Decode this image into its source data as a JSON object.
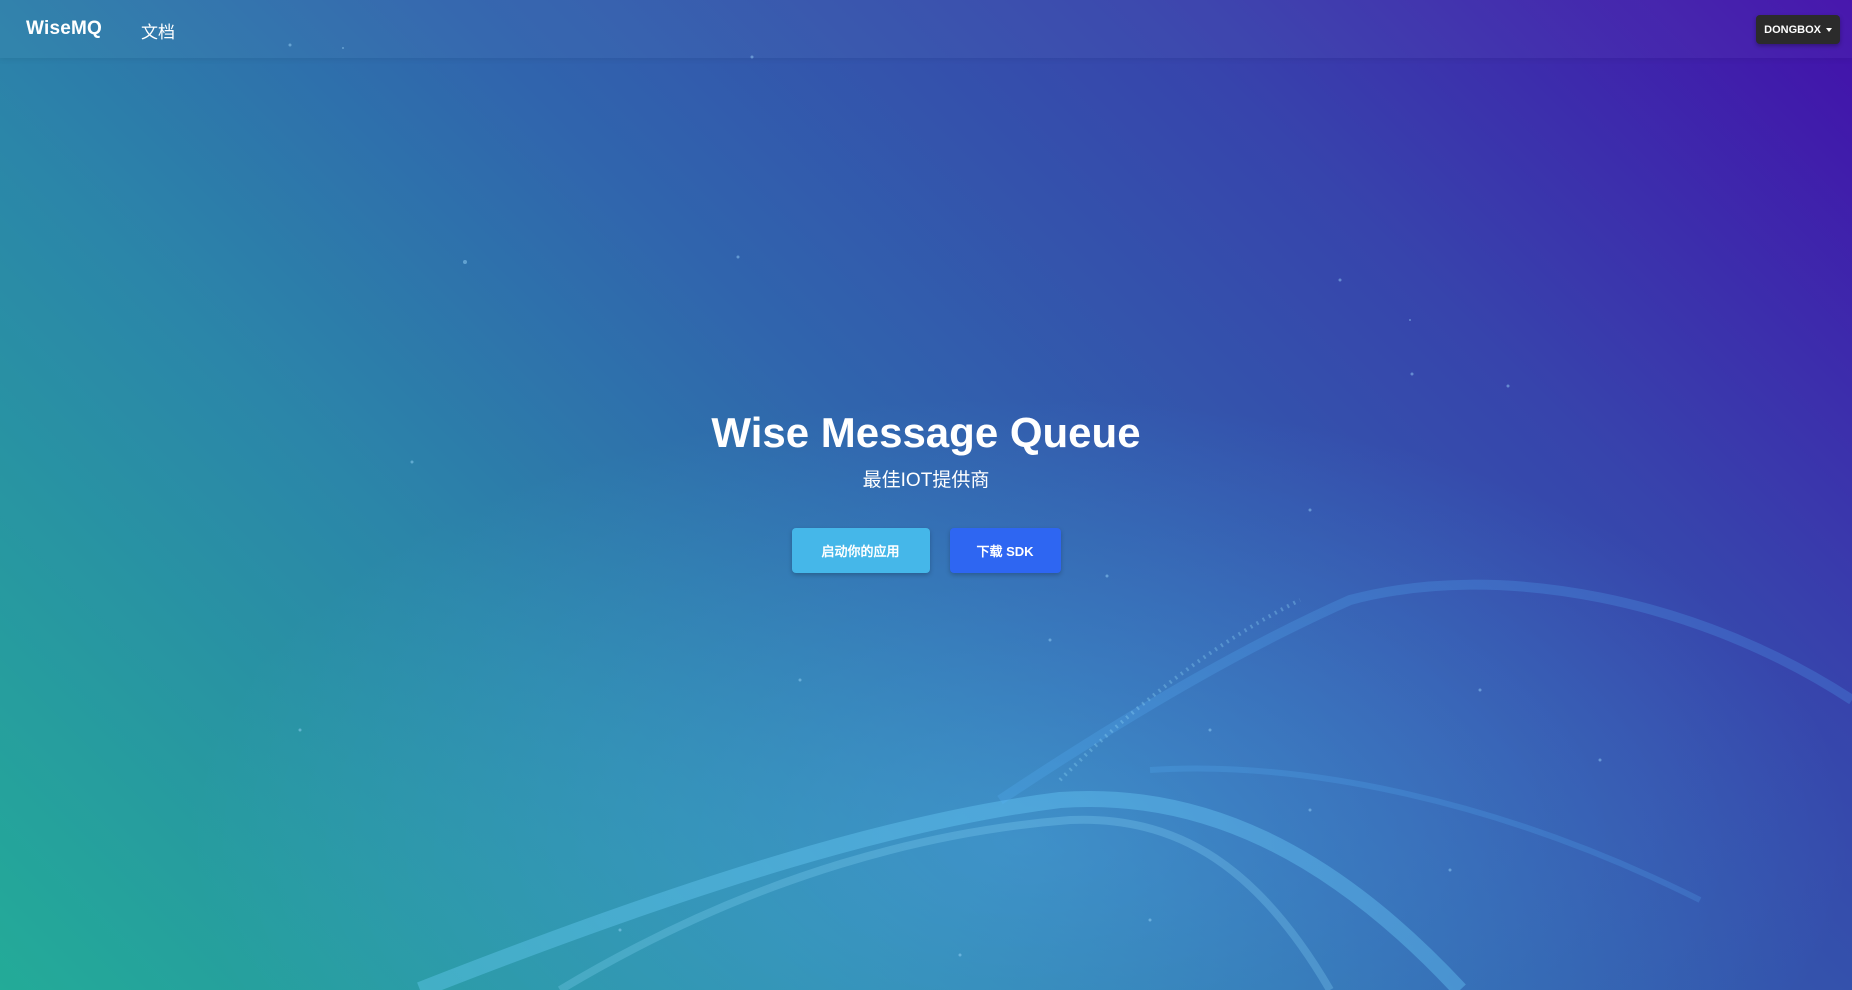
{
  "navbar": {
    "brand": "WiseMQ",
    "docs_link": "文档",
    "user_menu_label": "DONGBOX"
  },
  "hero": {
    "title": "Wise Message Queue",
    "subtitle": "最佳IOT提供商",
    "primary_button": "启动你的应用",
    "secondary_button": "下载 SDK"
  },
  "colors": {
    "primary_button": "#45b7e9",
    "secondary_button": "#2e66f2",
    "user_menu_bg": "#2b2b2b",
    "gradient_start": "#23ab98",
    "gradient_end": "#4310ab"
  }
}
